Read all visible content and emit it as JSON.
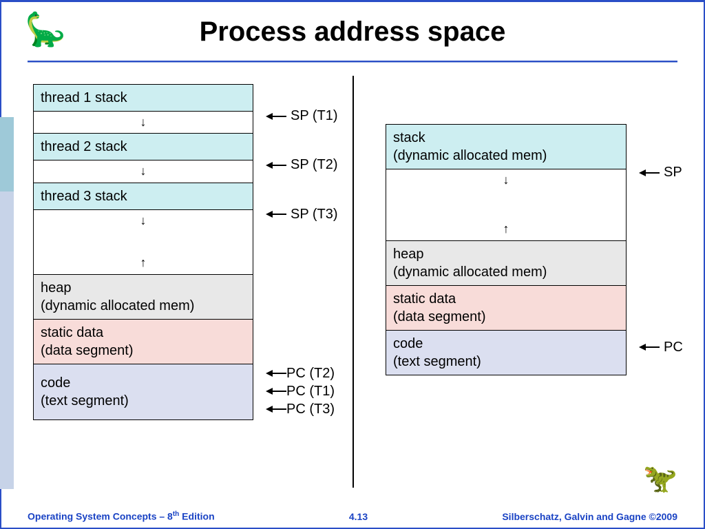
{
  "title": "Process address space",
  "footer": {
    "left_pre": "Operating System Concepts – 8",
    "left_sup": "th",
    "left_post": " Edition",
    "mid": "4.13",
    "right": "Silberschatz, Galvin and Gagne ©2009"
  },
  "icons": {
    "dino_left": "🦕",
    "dino_right": "🦖"
  },
  "left": {
    "t1": "thread 1 stack",
    "t2": "thread 2 stack",
    "t3": "thread 3 stack",
    "heap1": "heap",
    "heap2": "(dynamic allocated mem)",
    "static1": "static data",
    "static2": "(data segment)",
    "code1": "code",
    "code2": "(text segment)",
    "sp1": "SP (T1)",
    "sp2": "SP (T2)",
    "sp3": "SP (T3)",
    "pc1": "PC (T2)",
    "pc2": "PC (T1)",
    "pc3": "PC (T3)"
  },
  "right": {
    "stack1": "stack",
    "stack2": "(dynamic allocated mem)",
    "heap1": "heap",
    "heap2": "(dynamic allocated mem)",
    "static1": "static data",
    "static2": "(data segment)",
    "code1": "code",
    "code2": "(text segment)",
    "sp": "SP",
    "pc": "PC"
  }
}
